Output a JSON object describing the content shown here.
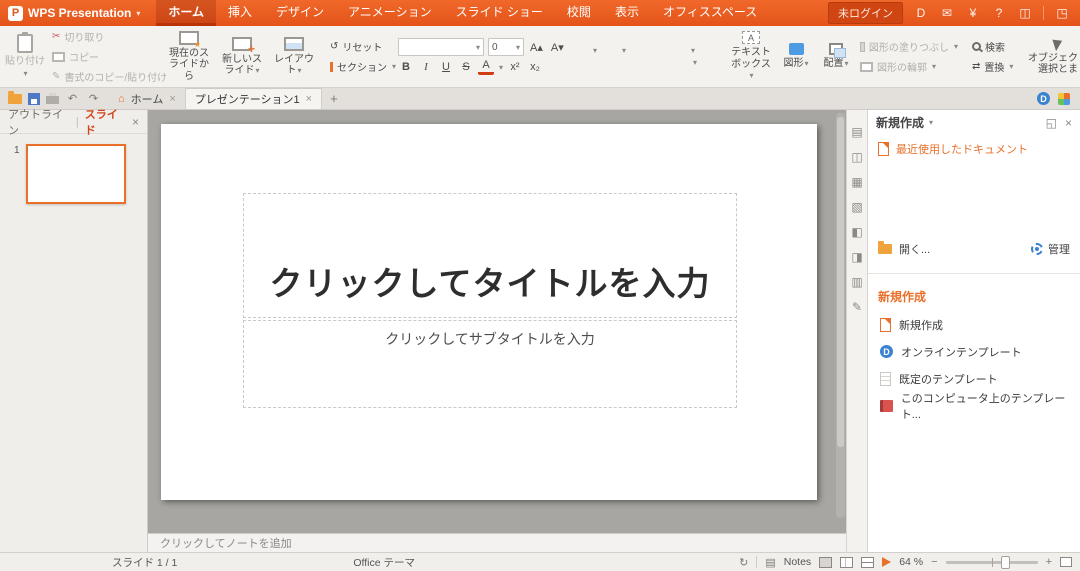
{
  "titlebar": {
    "app_name": "WPS Presentation",
    "login_label": "未ログイン",
    "tabs": [
      "ホーム",
      "挿入",
      "デザイン",
      "アニメーション",
      "スライド ショー",
      "校閲",
      "表示",
      "オフィススペース"
    ]
  },
  "ribbon": {
    "paste": "貼り付け",
    "cut": "切り取り",
    "copy": "コピー",
    "format_painter": "書式のコピー/貼り付け",
    "current_slide": "現在のスライドから",
    "new_slide": "新しいスライド",
    "layout": "レイアウト",
    "reset": "リセット",
    "section": "セクション",
    "font_name_value": "",
    "font_size_value": "0",
    "textbox": "テキストボックス",
    "shapes": "図形",
    "arrange": "配置",
    "shape_fill": "図形の塗りつぶし",
    "shape_outline": "図形の輪郭",
    "search": "検索",
    "replace": "置換",
    "object_select": "オブジェクト選択とま"
  },
  "tabbar": {
    "home_tab": "ホーム",
    "document_tab": "プレゼンテーション1"
  },
  "left_panel": {
    "outline_tab": "アウトライン",
    "slides_tab": "スライド",
    "slide_number": "1"
  },
  "slide": {
    "title_placeholder": "クリックしてタイトルを入力",
    "subtitle_placeholder": "クリックしてサブタイトルを入力"
  },
  "notes_placeholder": "クリックしてノートを追加",
  "right_panel": {
    "header": "新規作成",
    "recent_documents": "最近使用したドキュメント",
    "open": "開く...",
    "manage": "管理",
    "new_section": "新規作成",
    "items": [
      "新規作成",
      "オンラインテンプレート",
      "既定のテンプレート",
      "このコンピュータ上のテンプレート..."
    ]
  },
  "statusbar": {
    "slide_counter": "スライド 1 / 1",
    "theme": "Office テーマ",
    "notes_label": "Notes",
    "zoom_value": "64 %"
  },
  "colors": {
    "titlebar_orange": "#e85a1e",
    "accent_orange": "#e8702a",
    "active_tab_underline": "#b93208",
    "canvas_gray": "#a8a6a3"
  },
  "icons": {
    "caret": "▾",
    "close": "×",
    "plus": "+",
    "minus": "−",
    "docer": "D",
    "message": "✉",
    "premium": "¥",
    "help": "?",
    "skin": "◫",
    "pin": "◳",
    "scissors": "✂",
    "reset": "↺",
    "undo": "↶",
    "redo": "↷",
    "home": "⌂",
    "replace": "⇄",
    "bold": "B",
    "italic": "I",
    "underline": "U",
    "strike": "S",
    "font_color": "A",
    "superscript": "x²",
    "subscript": "x₂",
    "font_grow": "A▴",
    "font_shrink": "A▾",
    "refresh": "↻",
    "notes_box": "▤",
    "dock": "◱",
    "textbox_a": "A",
    "strip": [
      "▤",
      "◫",
      "▦",
      "▧",
      "◧",
      "◨",
      "▥",
      "✎"
    ]
  }
}
